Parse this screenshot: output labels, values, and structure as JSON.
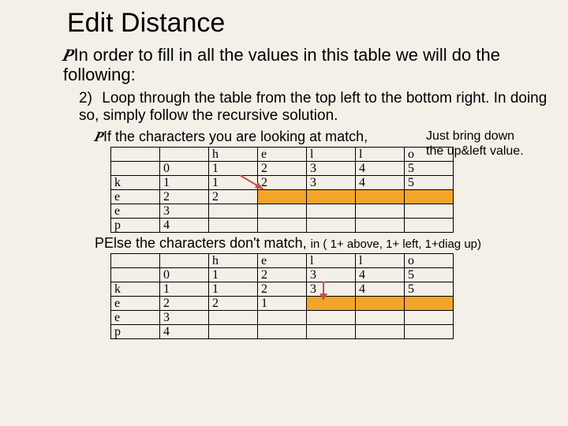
{
  "title": "Edit Distance",
  "intro": "In order to fill in all the values in this table we will do the following:",
  "step_num": "2)",
  "step_text": "Loop through the table from the top left to the bottom right. In doing so, simply follow the recursive solution.",
  "bullet_if": "If the characters you are looking at match,",
  "note_if_1": "Just bring down",
  "note_if_2": "the up&left value.",
  "else_lead": "Else the characters don't match,",
  "else_tail": "in ( 1+ above, 1+ left, 1+diag up)",
  "cols": [
    "",
    "",
    "h",
    "e",
    "l",
    "l",
    "o"
  ],
  "row_labels": [
    "",
    "k",
    "e",
    "e",
    "p"
  ],
  "table1": {
    "r0": [
      "",
      "0",
      "1",
      "2",
      "3",
      "4",
      "5"
    ],
    "r1": [
      "",
      "1",
      "1",
      "2",
      "3",
      "4",
      "5"
    ],
    "r2": [
      "",
      "2",
      "2",
      "",
      "",
      "",
      ""
    ],
    "r3": [
      "",
      "3",
      "",
      "",
      "",
      "",
      ""
    ],
    "r4": [
      "",
      "4",
      "",
      "",
      "",
      "",
      ""
    ]
  },
  "table2": {
    "r0": [
      "",
      "0",
      "1",
      "2",
      "3",
      "4",
      "5"
    ],
    "r1": [
      "",
      "1",
      "1",
      "2",
      "3",
      "4",
      "5"
    ],
    "r2": [
      "",
      "2",
      "2",
      "1",
      "",
      "",
      ""
    ],
    "r3": [
      "",
      "3",
      "",
      "",
      "",
      "",
      ""
    ],
    "r4": [
      "",
      "4",
      "",
      "",
      "",
      "",
      ""
    ]
  },
  "chart_data": [
    {
      "type": "table",
      "title": "Edit distance DP table (match case)",
      "col_headers": [
        "",
        "h",
        "e",
        "l",
        "l",
        "o"
      ],
      "row_headers": [
        "",
        "k",
        "e",
        "e",
        "p"
      ],
      "values": [
        [
          0,
          1,
          2,
          3,
          4,
          5
        ],
        [
          1,
          1,
          2,
          3,
          4,
          5
        ],
        [
          2,
          2,
          null,
          null,
          null,
          null
        ],
        [
          3,
          null,
          null,
          null,
          null,
          null
        ],
        [
          4,
          null,
          null,
          null,
          null,
          null
        ]
      ],
      "highlight_row": 2,
      "highlight_cols": [
        2,
        3,
        4,
        5
      ]
    },
    {
      "type": "table",
      "title": "Edit distance DP table (mismatch case)",
      "col_headers": [
        "",
        "h",
        "e",
        "l",
        "l",
        "o"
      ],
      "row_headers": [
        "",
        "k",
        "e",
        "e",
        "p"
      ],
      "values": [
        [
          0,
          1,
          2,
          3,
          4,
          5
        ],
        [
          1,
          1,
          2,
          3,
          4,
          5
        ],
        [
          2,
          2,
          1,
          null,
          null,
          null
        ],
        [
          3,
          null,
          null,
          null,
          null,
          null
        ],
        [
          4,
          null,
          null,
          null,
          null,
          null
        ]
      ],
      "highlight_row": 2,
      "highlight_cols": [
        3,
        4,
        5
      ]
    }
  ]
}
